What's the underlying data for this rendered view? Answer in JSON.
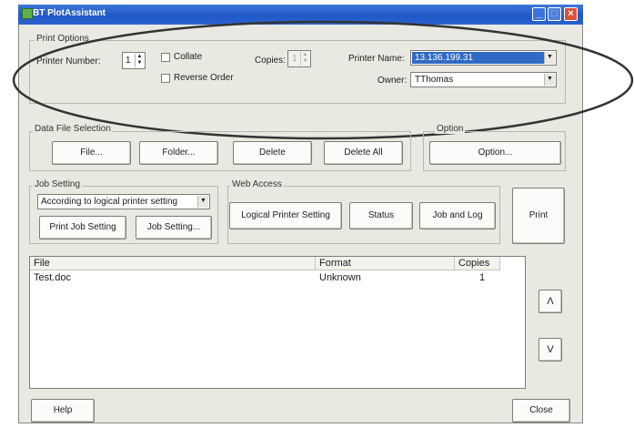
{
  "window": {
    "title": "BT PlotAssistant",
    "minimize": "_",
    "maximize": "□",
    "close": "×"
  },
  "print_options": {
    "group_label": "Print Options",
    "printer_number_label": "Printer Number:",
    "printer_number_value": "1",
    "collate_label": "Collate",
    "reverse_order_label": "Reverse Order",
    "copies_label": "Copies:",
    "copies_value": "1",
    "printer_name_label": "Printer Name:",
    "printer_name_value": "13.136.199.31",
    "owner_label": "Owner:",
    "owner_value": "TThomas"
  },
  "data_file_selection": {
    "group_label": "Data File Selection",
    "file_button": "File...",
    "folder_button": "Folder...",
    "delete_button": "Delete",
    "delete_all_button": "Delete All"
  },
  "option": {
    "group_label": "Option",
    "option_button": "Option..."
  },
  "job_setting": {
    "group_label": "Job Setting",
    "select_value": "According to logical printer setting",
    "print_job_setting_button": "Print Job Setting",
    "job_setting_button": "Job Setting..."
  },
  "web_access": {
    "group_label": "Web Access",
    "logical_printer_setting_button": "Logical Printer Setting",
    "status_button": "Status",
    "job_and_log_button": "Job and Log"
  },
  "print_button": "Print",
  "file_list": {
    "headers": {
      "file": "File",
      "format": "Format",
      "copies": "Copies"
    },
    "rows": [
      {
        "file": "Test.doc",
        "format": "Unknown",
        "copies": "1"
      }
    ]
  },
  "up_button": "Λ",
  "down_button": "V",
  "help_button": "Help",
  "close_button": "Close",
  "colors": {
    "title_bar": "#2a63cf",
    "selection": "#316ac5",
    "window_bg": "#e9e8e1"
  }
}
